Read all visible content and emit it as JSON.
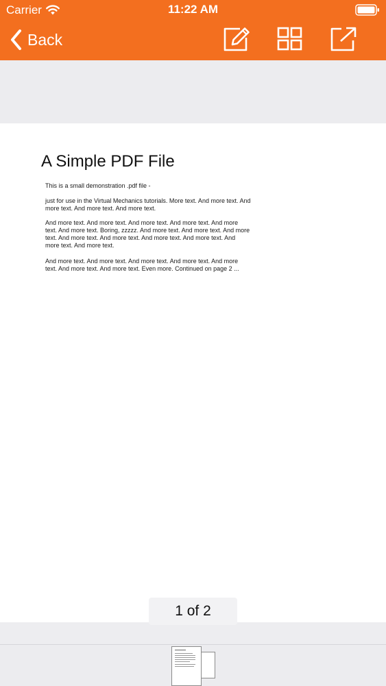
{
  "status_bar": {
    "carrier": "Carrier",
    "time": "11:22 AM",
    "wifi_icon": "wifi-icon",
    "battery_icon": "battery-icon"
  },
  "nav": {
    "back_label": "Back",
    "icons": [
      "chevron-left-icon",
      "edit-icon",
      "grid-icon",
      "share-icon"
    ],
    "accent_color": "#f36f1f"
  },
  "document": {
    "title": "A Simple PDF File",
    "paragraphs": [
      "This is a small demonstration .pdf file -",
      "just for use in the Virtual Mechanics tutorials. More text. And more text. And more text. And more text. And more text.",
      "And more text. And more text. And more text. And more text. And more text. And more text. Boring, zzzzz. And more text. And more text. And more text. And more text. And more text. And more text. And more text. And more text. And more text.",
      "And more text. And more text. And more text. And more text. And more text. And more text. And more text. Even more. Continued on page 2 ..."
    ]
  },
  "pager": {
    "indicator": "1 of 2",
    "current_page": 1,
    "total_pages": 2
  }
}
